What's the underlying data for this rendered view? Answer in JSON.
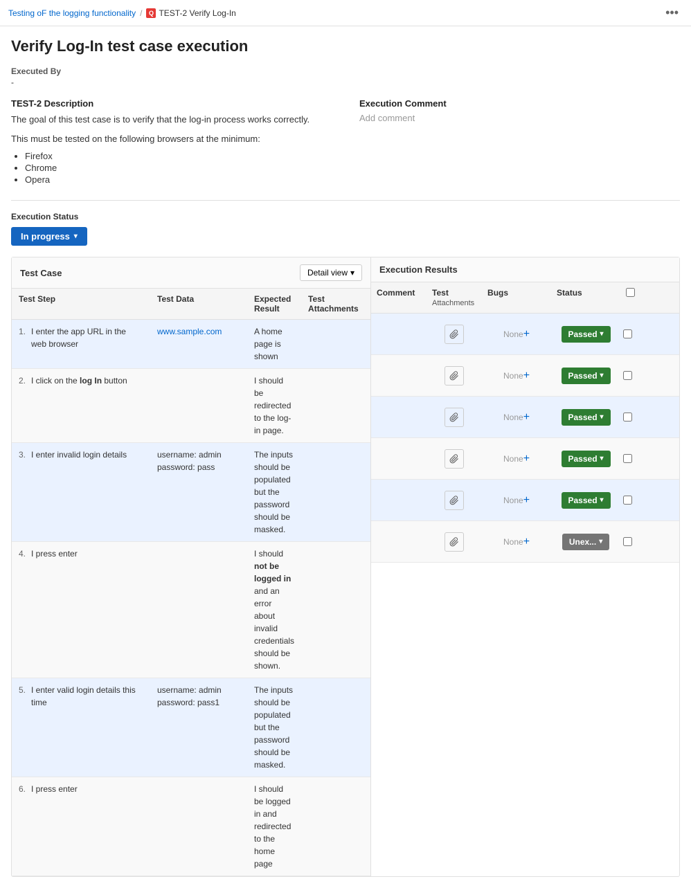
{
  "breadcrumb": {
    "parent": "Testing oF the logging functionality",
    "separator": "/",
    "icon": "Q",
    "current": "TEST-2 Verify Log-In"
  },
  "page_title": "Verify Log-In test case execution",
  "executed_by": {
    "label": "Executed By",
    "value": "-"
  },
  "description": {
    "heading": "TEST-2 Description",
    "text1": "The goal of this test case is to verify that the log-in process works correctly.",
    "text2": "This must be tested on the following browsers at the minimum:",
    "browsers": [
      "Firefox",
      "Chrome",
      "Opera"
    ]
  },
  "execution_comment": {
    "heading": "Execution Comment",
    "placeholder": "Add comment"
  },
  "execution_status": {
    "label": "Execution Status",
    "button": "In progress",
    "chevron": "▾"
  },
  "test_case": {
    "title": "Test Case",
    "view_btn": "Detail view",
    "columns": [
      "Test Step",
      "Test Data",
      "Expected Result",
      "Test Attachments"
    ],
    "rows": [
      {
        "num": "1.",
        "step": "I enter the app URL in the web browser",
        "test_data": "www.sample.com",
        "expected": "A home page is shown",
        "attachments": ""
      },
      {
        "num": "2.",
        "step_pre": "I click on the ",
        "step_bold": "log In",
        "step_post": " button",
        "test_data": "",
        "expected": "I should be redirected to the log-in page.",
        "attachments": ""
      },
      {
        "num": "3.",
        "step": "I enter invalid login details",
        "test_data": "username: admin\npassword: pass",
        "expected": "The inputs should be populated but the password should be masked.",
        "attachments": ""
      },
      {
        "num": "4.",
        "step": "I press enter",
        "test_data": "",
        "expected_pre": "I should ",
        "expected_bold": "not be logged in",
        "expected_post": " and an error about invalid credentials should be shown.",
        "attachments": ""
      },
      {
        "num": "5.",
        "step": "I enter valid login details this time",
        "test_data": "username: admin\npassword: pass1",
        "expected": "The inputs should be populated but the password should be masked.",
        "attachments": ""
      },
      {
        "num": "6.",
        "step": "I press enter",
        "test_data": "",
        "expected": "I should be logged in and redirected to the home page",
        "attachments": ""
      }
    ]
  },
  "execution_results": {
    "title": "Execution Results",
    "columns": {
      "comment": "Comment",
      "test_attachments": "Test\nAttachments",
      "bugs": "Bugs",
      "status": "Status"
    },
    "rows": [
      {
        "status": "Passed",
        "status_type": "passed",
        "bugs": "None"
      },
      {
        "status": "Passed",
        "status_type": "passed",
        "bugs": "None"
      },
      {
        "status": "Passed",
        "status_type": "passed",
        "bugs": "None"
      },
      {
        "status": "Passed",
        "status_type": "passed",
        "bugs": "None"
      },
      {
        "status": "Passed",
        "status_type": "passed",
        "bugs": "None"
      },
      {
        "status": "Unex...",
        "status_type": "unexplored",
        "bugs": "None"
      }
    ]
  },
  "dots_menu": "•••"
}
